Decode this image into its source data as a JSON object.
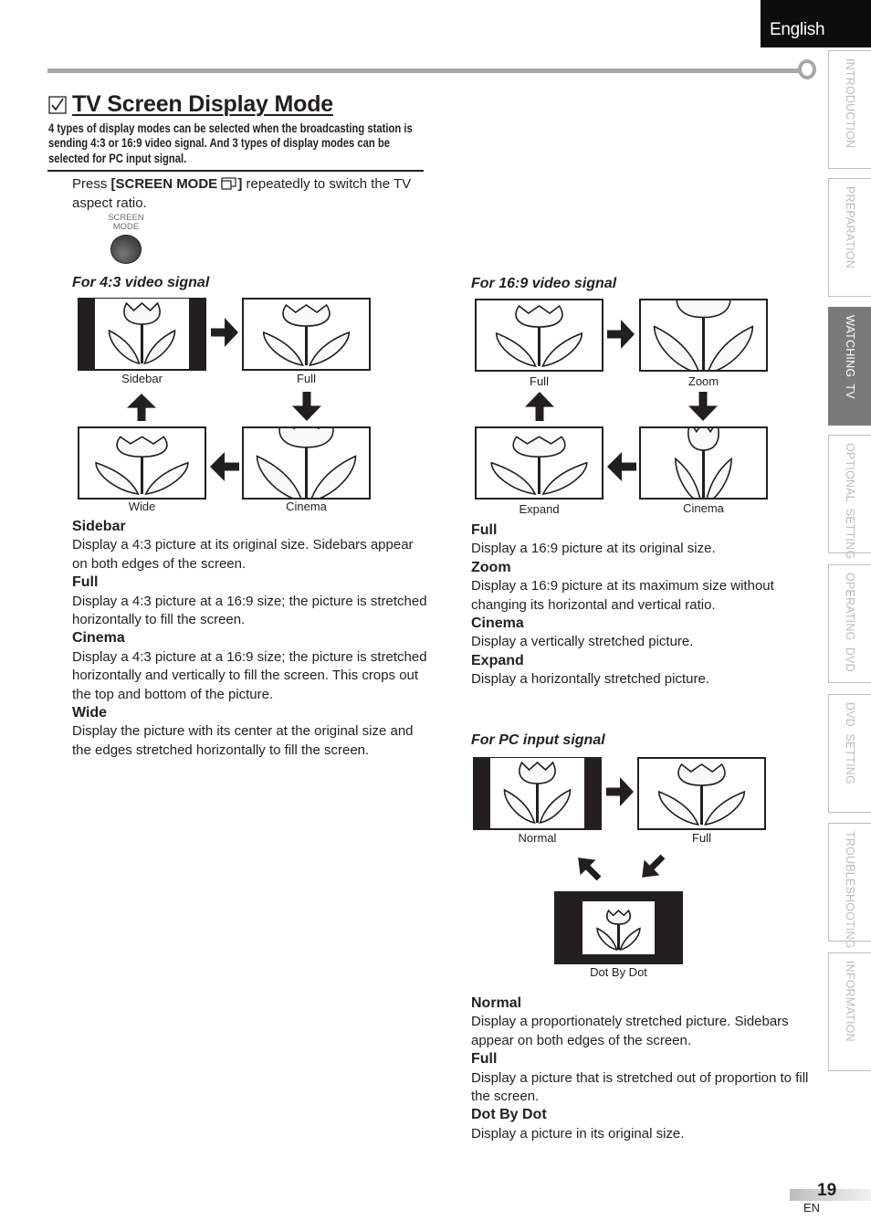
{
  "header": {
    "language_tab": "English"
  },
  "side_nav": {
    "items": [
      {
        "label": "INTRODUCTION",
        "active": false
      },
      {
        "label": "PREPARATION",
        "active": false
      },
      {
        "label": "WATCHING  TV",
        "active": true
      },
      {
        "label": "OPTIONAL  SETTING",
        "active": false
      },
      {
        "label": "OPERATING  DVD",
        "active": false
      },
      {
        "label": "DVD  SETTING",
        "active": false
      },
      {
        "label": "TROUBLESHOOTING",
        "active": false
      },
      {
        "label": "INFORMATION",
        "active": false
      }
    ]
  },
  "page": {
    "title": "TV Screen Display Mode",
    "title_icon": "checkbox-checked-icon",
    "intro": "4 types of display modes can be selected when the broadcasting station is sending 4:3 or 16:9 video signal. And 3 types of display modes can be selected for PC input signal.",
    "instruction_prefix": "Press ",
    "instruction_key": "[SCREEN MODE ",
    "instruction_key_icon": "screen-mode-icon",
    "instruction_key_close": "]",
    "instruction_suffix": " repeatedly to switch the TV aspect ratio.",
    "button_label_line1": "SCREEN",
    "button_label_line2": "MODE"
  },
  "signal_43": {
    "heading": "For 4:3 video signal",
    "modes": [
      "Sidebar",
      "Full",
      "Cinema",
      "Wide"
    ],
    "descriptions": [
      {
        "term": "Sidebar",
        "text": "Display a 4:3 picture at its original size. Sidebars appear on both edges of the screen."
      },
      {
        "term": "Full",
        "text": "Display a 4:3 picture at a 16:9 size; the picture is stretched horizontally to fill the screen."
      },
      {
        "term": "Cinema",
        "text": "Display a 4:3 picture at a 16:9 size; the picture is stretched horizontally and vertically to fill the screen. This crops out the top and bottom of the picture."
      },
      {
        "term": "Wide",
        "text": "Display the picture with its center at the original size and the edges stretched horizontally to fill the screen."
      }
    ]
  },
  "signal_169": {
    "heading": "For 16:9 video signal",
    "modes": [
      "Full",
      "Zoom",
      "Cinema",
      "Expand"
    ],
    "descriptions": [
      {
        "term": "Full",
        "text": "Display a 16:9 picture at its original size."
      },
      {
        "term": "Zoom",
        "text": "Display a 16:9 picture at its maximum size without changing its horizontal and vertical ratio."
      },
      {
        "term": "Cinema",
        "text": "Display a vertically stretched picture."
      },
      {
        "term": "Expand",
        "text": "Display a horizontally stretched picture."
      }
    ]
  },
  "signal_pc": {
    "heading": "For PC input signal",
    "modes": [
      "Normal",
      "Full",
      "Dot By Dot"
    ],
    "descriptions": [
      {
        "term": "Normal",
        "text": "Display a proportionately stretched picture. Sidebars appear on both edges of the screen."
      },
      {
        "term": "Full",
        "text": "Display a picture that is stretched out of proportion to fill the screen."
      },
      {
        "term": "Dot By Dot",
        "text": "Display a picture in its original size."
      }
    ]
  },
  "footer": {
    "page_number": "19",
    "language_code": "EN"
  },
  "colors": {
    "text": "#231f20",
    "rule_gray": "#a7a7a7",
    "active_tab": "#7a7a7a",
    "inactive_tab_text": "#bdbdbd"
  }
}
